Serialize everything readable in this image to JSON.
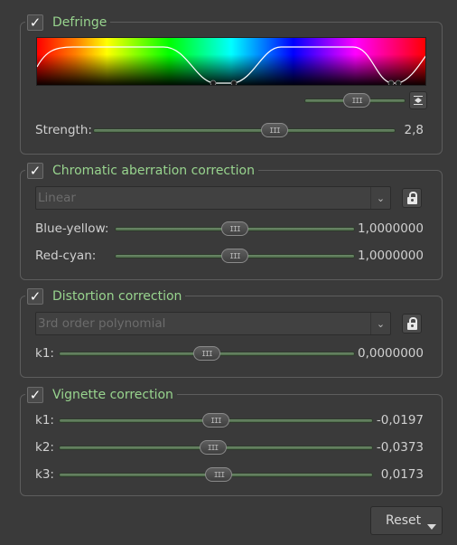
{
  "defringe": {
    "title": "Defringe",
    "checked": true,
    "strength_label": "Strength:",
    "strength_value": "2,8",
    "strength_fraction": 0.6,
    "small_slider_fraction": 0.52,
    "button_icon": "fit-arrows-icon"
  },
  "chromatic": {
    "title": "Chromatic aberration correction",
    "checked": true,
    "mode_value": "Linear",
    "blue_yellow_label": "Blue-yellow:",
    "blue_yellow_value": "1,0000000",
    "blue_yellow_fraction": 0.5,
    "red_cyan_label": "Red-cyan:",
    "red_cyan_value": "1,0000000",
    "red_cyan_fraction": 0.5
  },
  "distortion": {
    "title": "Distortion correction",
    "checked": true,
    "mode_value": "3rd order polynomial",
    "k1_label": "k1:",
    "k1_value": "0,0000000",
    "k1_fraction": 0.5
  },
  "vignette": {
    "title": "Vignette correction",
    "checked": true,
    "k1_label": "k1:",
    "k1_value": "-0,0197",
    "k1_fraction": 0.5,
    "k2_label": "k2:",
    "k2_value": "-0,0373",
    "k2_fraction": 0.49,
    "k3_label": "k3:",
    "k3_value": "0,0173",
    "k3_fraction": 0.51
  },
  "footer": {
    "reset_label": "Reset"
  },
  "colors": {
    "title_green": "#98d48e",
    "background": "#3a3a3a",
    "track_green": "#5d7a59"
  }
}
